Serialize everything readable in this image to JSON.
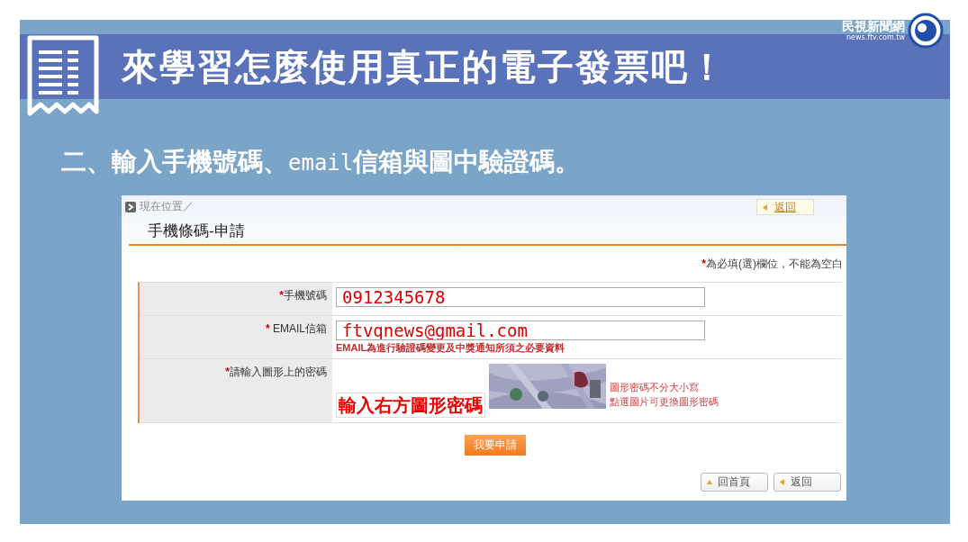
{
  "header": {
    "title": "來學習怎麼使用真正的電子發票吧！",
    "logo": {
      "name": "民視新聞網",
      "url": "news.ftv.com.tw"
    }
  },
  "subtitle": [
    {
      "text": "二、輸入手機號碼、",
      "kind": "plain"
    },
    {
      "text": "email",
      "kind": "mono"
    },
    {
      "text": "信箱與圖中驗證碼。",
      "kind": "plain"
    }
  ],
  "form": {
    "breadcrumb": "現在位置／",
    "back_link": "返回",
    "heading": "手機條碼-申請",
    "required_note": {
      "mark": "*",
      "text": "為必填(選)欄位，不能為空白"
    },
    "fields": [
      {
        "kind": "text",
        "label": "手機號碼",
        "required": true,
        "mark": "*",
        "value": "0912345678"
      },
      {
        "kind": "text",
        "label": " EMAIL信箱",
        "required": true,
        "mark": "*",
        "value": "ftvqnews@gmail.com",
        "hint": "EMAIL為進行驗證碼變更及中獎通知所須之必要資料"
      },
      {
        "kind": "captcha",
        "label": "請輸入圖形上的密碼",
        "required": true,
        "mark": "*",
        "annotation": "輸入右方圖形密碼",
        "notes": [
          "圖形密碼不分大小寫",
          "點選圖片可更換圖形密碼"
        ]
      }
    ],
    "submit": "我要申請",
    "bottom_buttons": [
      {
        "label": "回首頁",
        "kind": "up"
      },
      {
        "label": "返回",
        "kind": "back"
      }
    ]
  }
}
